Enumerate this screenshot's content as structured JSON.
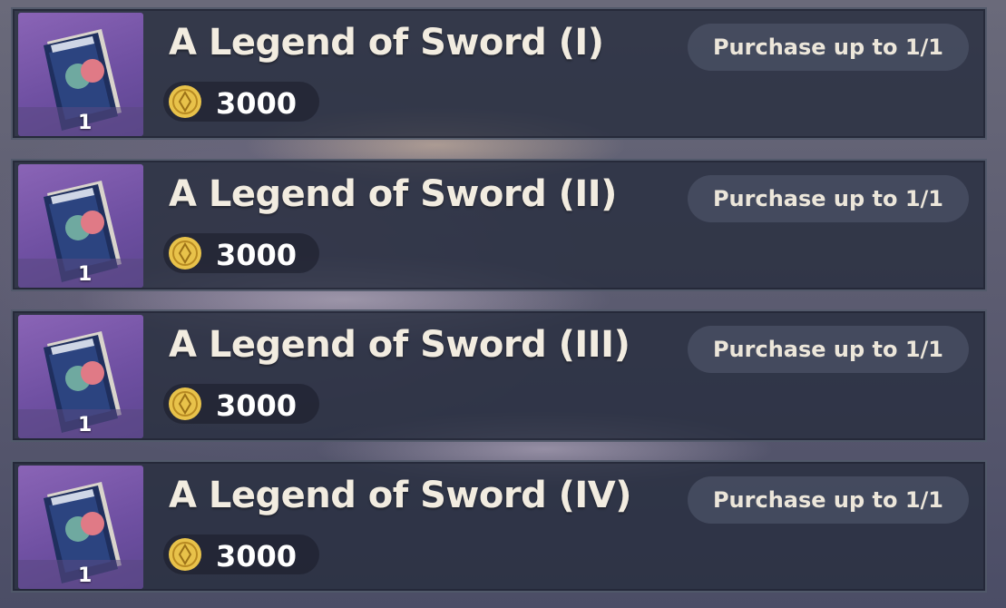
{
  "items": [
    {
      "title": "A Legend of Sword (I)",
      "quantity": "1",
      "price": "3000",
      "limit": "Purchase up to 1/1",
      "icon": "book-icon",
      "currency_icon": "mora-coin-icon"
    },
    {
      "title": "A Legend of Sword (II)",
      "quantity": "1",
      "price": "3000",
      "limit": "Purchase up to 1/1",
      "icon": "book-icon",
      "currency_icon": "mora-coin-icon"
    },
    {
      "title": "A Legend of Sword (III)",
      "quantity": "1",
      "price": "3000",
      "limit": "Purchase up to 1/1",
      "icon": "book-icon",
      "currency_icon": "mora-coin-icon"
    },
    {
      "title": "A Legend of Sword (IV)",
      "quantity": "1",
      "price": "3000",
      "limit": "Purchase up to 1/1",
      "icon": "book-icon",
      "currency_icon": "mora-coin-icon"
    }
  ],
  "colors": {
    "card_bg": "#282e40",
    "thumb_purple": "#7a58ac",
    "title_text": "#f2ece0",
    "coin_gold": "#e8c24a"
  }
}
